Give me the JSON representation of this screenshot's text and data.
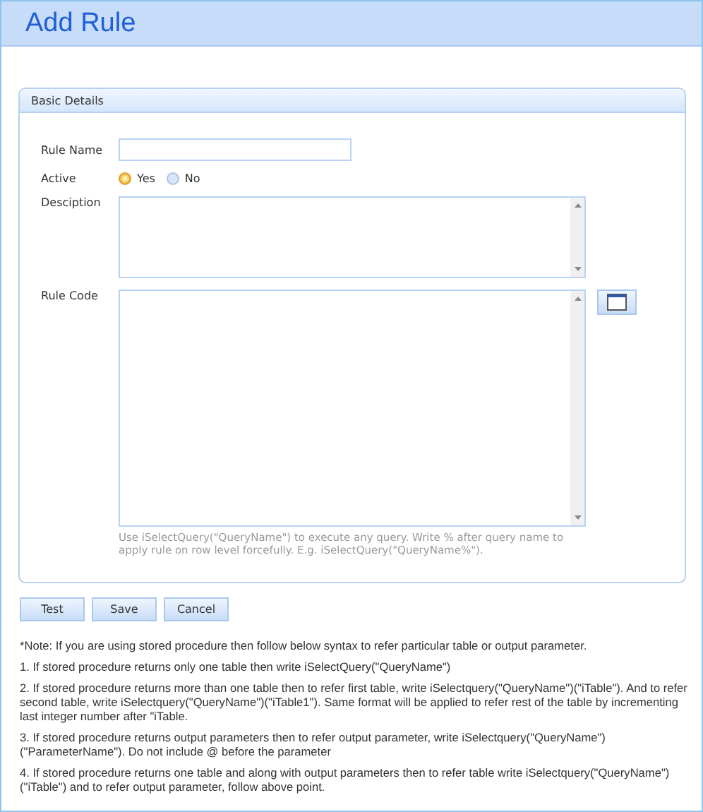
{
  "window": {
    "title": "Add Rule"
  },
  "panel": {
    "title": "Basic Details"
  },
  "form": {
    "rule_name": {
      "label": "Rule Name"
    },
    "active": {
      "label": "Active",
      "options": [
        {
          "label": "Yes",
          "selected": true
        },
        {
          "label": "No",
          "selected": false
        }
      ]
    },
    "description": {
      "label": "Desciption"
    },
    "rule_code": {
      "label": "Rule Code",
      "hint": "Use iSelectQuery(\"QueryName\") to execute any query. Write % after query name to apply rule on row level forcefully. E.g. iSelectQuery(\"QueryName%\")."
    }
  },
  "buttons": [
    "Test",
    "Save",
    "Cancel"
  ],
  "notes": [
    "*Note: If you are using stored procedure then follow below syntax to refer particular table or output parameter.",
    "1. If stored procedure returns only one table then write iSelectQuery(\"QueryName\")",
    "2. If stored procedure returns more than one table then to refer first table, write iSelectquery(\"QueryName\")(\"iTable\"). And to refer second table, write iSelectquery(\"QueryName\")(\"iTable1\"). Same format will be applied to refer rest of the table by incrementing last integer number after \"iTable.",
    "3. If stored procedure returns output parameters then to refer output parameter, write iSelectquery(\"QueryName\")(\"ParameterName\"). Do not include @ before the parameter",
    "4. If stored procedure returns one table and along with output parameters then to refer table write iSelectquery(\"QueryName\")(\"iTable\") and to refer output parameter, follow above point."
  ]
}
